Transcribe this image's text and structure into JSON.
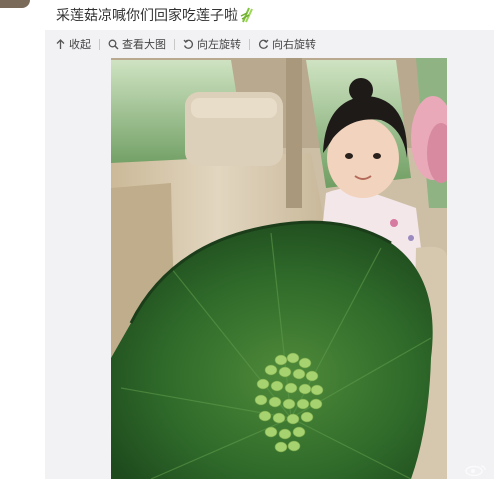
{
  "post": {
    "text": "采莲菇凉喊你们回家吃莲子啦"
  },
  "toolbar": {
    "items": [
      {
        "icon": "collapse-icon",
        "label": "收起"
      },
      {
        "icon": "magnifier-icon",
        "label": "查看大图"
      },
      {
        "icon": "rotate-left-icon",
        "label": "向左旋转"
      },
      {
        "icon": "rotate-right-icon",
        "label": "向右旋转"
      }
    ]
  },
  "photo": {
    "description_icon": "photo-lotus-girl",
    "watermark_icon": "weibo-logo-icon"
  },
  "colors": {
    "panel_bg": "#f2f2f5",
    "leaf_green": "#2f6a2a",
    "seed_green": "#9fcf6a",
    "car_beige": "#d9cbb3"
  }
}
